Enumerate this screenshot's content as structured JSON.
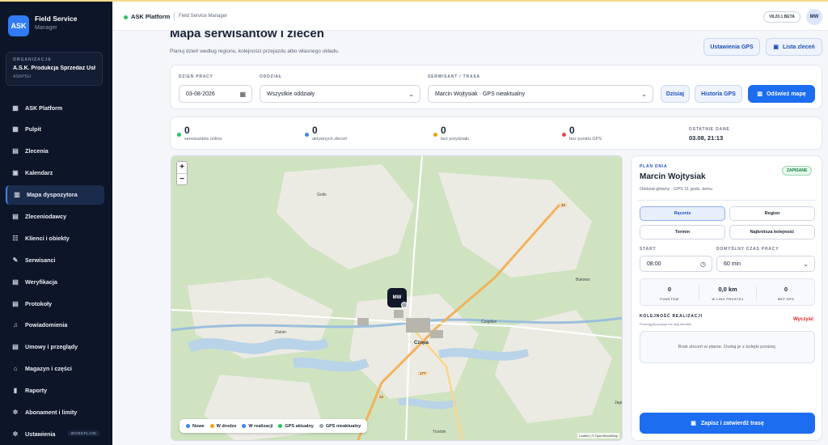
{
  "sidebar": {
    "logo": "ASK",
    "brand_title": "Field Service",
    "brand_sub": "Manager",
    "org_label": "ORGANIZACJA",
    "org_name": "A.S.K. Produkcja Sprzedaż Usł...",
    "org_code": "ASKPSU",
    "items": [
      {
        "label": "ASK Platform",
        "icon": "grid-icon",
        "glyph": "▦"
      },
      {
        "label": "Pulpit",
        "icon": "dashboard-icon",
        "glyph": "▦"
      },
      {
        "label": "Zlecenia",
        "icon": "orders-icon",
        "glyph": "▤"
      },
      {
        "label": "Kalendarz",
        "icon": "calendar-icon",
        "glyph": "▣"
      },
      {
        "label": "Mapa dyspozytora",
        "icon": "map-icon",
        "glyph": "▥"
      },
      {
        "label": "Zleceniodawcy",
        "icon": "clients-icon",
        "glyph": "▤"
      },
      {
        "label": "Klienci i obiekty",
        "icon": "people-icon",
        "glyph": "☷"
      },
      {
        "label": "Serwisanci",
        "icon": "wrench-icon",
        "glyph": "✎"
      },
      {
        "label": "Weryfikacja",
        "icon": "verify-icon",
        "glyph": "▤"
      },
      {
        "label": "Protokoły",
        "icon": "protocol-icon",
        "glyph": "▤"
      },
      {
        "label": "Powiadomienia",
        "icon": "bell-icon",
        "glyph": "♫"
      },
      {
        "label": "Umowy i przeglądy",
        "icon": "contract-icon",
        "glyph": "▤"
      },
      {
        "label": "Magazyn i części",
        "icon": "warehouse-icon",
        "glyph": "⌂"
      },
      {
        "label": "Raporty",
        "icon": "chart-icon",
        "glyph": "▮"
      },
      {
        "label": "Abonament i limity",
        "icon": "gear-icon",
        "glyph": "✲"
      },
      {
        "label": "Ustawienia",
        "icon": "settings-icon",
        "glyph": "✲"
      }
    ],
    "settings_badge": "WORKFLOW",
    "active_index": 4
  },
  "header": {
    "app": "ASK Platform",
    "sub": "Field Service Manager",
    "version": "V8.20.1 BETA",
    "avatar": "MW"
  },
  "page": {
    "title": "Mapa serwisantów i zleceń",
    "subtitle": "Planuj dzień według regionu, kolejności przejazdu albo własnego układu.",
    "btn_gps": "Ustawienia GPS",
    "btn_orders": "Lista zleceń"
  },
  "filters": {
    "day_label": "DZIEŃ PRACY",
    "day_value": "03-08-2026",
    "branch_label": "ODDZIAŁ",
    "branch_value": "Wszystkie oddziały",
    "tech_label": "SERWISANT / TRASA",
    "tech_value": "Marcin Wojtysiak · GPS nieaktualny",
    "btn_today": "Dzisiaj",
    "btn_history": "Historia GPS",
    "btn_refresh": "Odśwież mapę"
  },
  "stats": [
    {
      "value": "0",
      "label": "serwisantów online",
      "color": "#22c55e"
    },
    {
      "value": "0",
      "label": "aktywnych zleceń",
      "color": "#3b82f6"
    },
    {
      "value": "0",
      "label": "bez przydziału",
      "color": "#f59e0b"
    },
    {
      "value": "0",
      "label": "bez punktu GPS",
      "color": "#ef4444"
    }
  ],
  "last_data": {
    "label": "OSTATNIE DANE",
    "value": "03.08, 21:13"
  },
  "map": {
    "marker": "MW",
    "places": [
      "Golin",
      "Bukowo",
      "Zalom",
      "Czaplice",
      "Czopa",
      "Trzebin",
      "Jagi"
    ],
    "roads": [
      "22",
      "177",
      "22"
    ],
    "legend": [
      {
        "label": "Nowe",
        "color": "#3b82f6"
      },
      {
        "label": "W drodze",
        "color": "#f59e0b"
      },
      {
        "label": "W realizacji",
        "color": "#3b82f6"
      },
      {
        "label": "GPS aktualny",
        "color": "#22c55e"
      },
      {
        "label": "GPS nieaktualny",
        "color": "#9ca3af"
      }
    ],
    "attribution": "Leaflet | © OpenStreetMap"
  },
  "plan": {
    "label": "PLAN DNIA",
    "name": "Marcin Wojtysiak",
    "saved": "ZAPISANE",
    "sub": "Oddział główny · GPS 11 godz. temu",
    "modes": [
      "Ręcznie",
      "Region",
      "Termin",
      "Najkrótsza kolejność"
    ],
    "start_label": "START",
    "start_value": "08:00",
    "duration_label": "DOMYŚLNY CZAS PRACY",
    "duration_value": "60 min",
    "metrics": [
      {
        "value": "0",
        "label": "PUNKTÓW"
      },
      {
        "value": "0,0 km",
        "label": "W LINII PROSTEJ"
      },
      {
        "value": "0",
        "label": "BEZ GPS"
      }
    ],
    "order_label": "KOLEJNOŚĆ REALIZACJI",
    "order_clear": "Wyczyść",
    "order_hint": "Przeciągnij pozycje lub użyj strzałek",
    "empty": "Brak zleceń w planie. Dodaj je z kolejki poniżej.",
    "save_btn": "Zapisz i zatwierdź trasę"
  }
}
